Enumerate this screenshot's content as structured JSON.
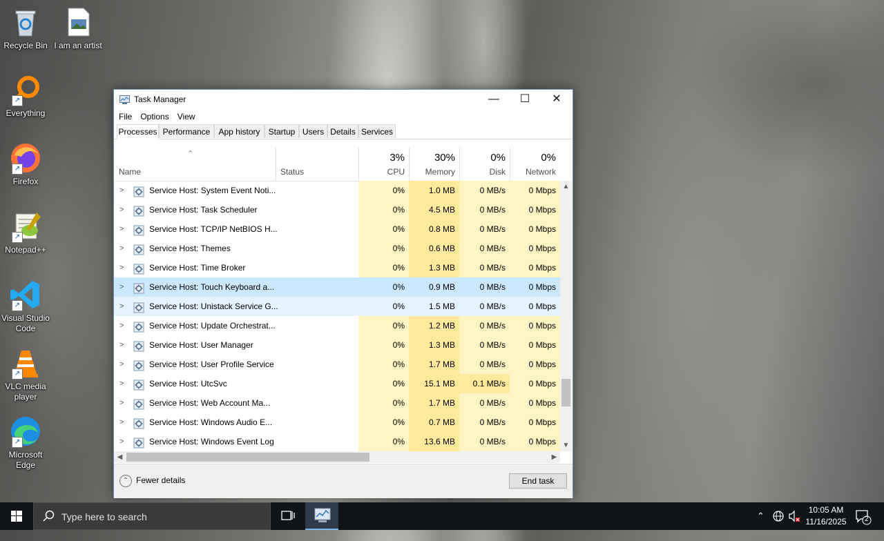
{
  "desktop": {
    "icons": [
      {
        "label": "Recycle Bin",
        "icon": "recycle-bin-icon"
      },
      {
        "label": "I am an artist",
        "icon": "image-file-icon"
      },
      {
        "label": "Everything",
        "icon": "everything-search-icon"
      },
      {
        "label": "Firefox",
        "icon": "firefox-icon"
      },
      {
        "label": "Notepad++",
        "icon": "notepad-plus-plus-icon"
      },
      {
        "label": "Visual Studio Code",
        "icon": "vscode-icon"
      },
      {
        "label": "VLC media player",
        "icon": "vlc-icon"
      },
      {
        "label": "Microsoft Edge",
        "icon": "edge-icon"
      }
    ]
  },
  "window": {
    "title": "Task Manager",
    "controls": {
      "minimize": "—",
      "maximize": "☐",
      "close": "✕"
    },
    "menu": [
      "File",
      "Options",
      "View"
    ],
    "tabs": [
      "Processes",
      "Performance",
      "App history",
      "Startup",
      "Users",
      "Details",
      "Services"
    ],
    "active_tab": "Processes"
  },
  "columns": {
    "name": "Name",
    "status": "Status",
    "cpu": {
      "pct": "3%",
      "label": "CPU"
    },
    "memory": {
      "pct": "30%",
      "label": "Memory"
    },
    "disk": {
      "pct": "0%",
      "label": "Disk"
    },
    "network": {
      "pct": "0%",
      "label": "Network"
    }
  },
  "rows": [
    {
      "name": "Service Host: System Event Noti...",
      "cpu": "0%",
      "memory": "1.0 MB",
      "disk": "0 MB/s",
      "network": "0 Mbps"
    },
    {
      "name": "Service Host: Task Scheduler",
      "cpu": "0%",
      "memory": "4.5 MB",
      "disk": "0 MB/s",
      "network": "0 Mbps"
    },
    {
      "name": "Service Host: TCP/IP NetBIOS H...",
      "cpu": "0%",
      "memory": "0.8 MB",
      "disk": "0 MB/s",
      "network": "0 Mbps"
    },
    {
      "name": "Service Host: Themes",
      "cpu": "0%",
      "memory": "0.6 MB",
      "disk": "0 MB/s",
      "network": "0 Mbps"
    },
    {
      "name": "Service Host: Time Broker",
      "cpu": "0%",
      "memory": "1.3 MB",
      "disk": "0 MB/s",
      "network": "0 Mbps"
    },
    {
      "name": "Service Host: Touch Keyboard a...",
      "cpu": "0%",
      "memory": "0.9 MB",
      "disk": "0 MB/s",
      "network": "0 Mbps"
    },
    {
      "name": "Service Host: Unistack Service G...",
      "cpu": "0%",
      "memory": "1.5 MB",
      "disk": "0 MB/s",
      "network": "0 Mbps"
    },
    {
      "name": "Service Host: Update Orchestrat...",
      "cpu": "0%",
      "memory": "1.2 MB",
      "disk": "0 MB/s",
      "network": "0 Mbps"
    },
    {
      "name": "Service Host: User Manager",
      "cpu": "0%",
      "memory": "1.3 MB",
      "disk": "0 MB/s",
      "network": "0 Mbps"
    },
    {
      "name": "Service Host: User Profile Service",
      "cpu": "0%",
      "memory": "1.7 MB",
      "disk": "0 MB/s",
      "network": "0 Mbps"
    },
    {
      "name": "Service Host: UtcSvc",
      "cpu": "0%",
      "memory": "15.1 MB",
      "disk": "0.1 MB/s",
      "network": "0 Mbps"
    },
    {
      "name": "Service Host: Web Account Ma...",
      "cpu": "0%",
      "memory": "1.7 MB",
      "disk": "0 MB/s",
      "network": "0 Mbps"
    },
    {
      "name": "Service Host: Windows Audio E...",
      "cpu": "0%",
      "memory": "0.7 MB",
      "disk": "0 MB/s",
      "network": "0 Mbps"
    },
    {
      "name": "Service Host: Windows Event Log",
      "cpu": "0%",
      "memory": "13.6 MB",
      "disk": "0 MB/s",
      "network": "0 Mbps"
    }
  ],
  "footer": {
    "fewer_details": "Fewer details",
    "end_task": "End task"
  },
  "taskbar": {
    "search_placeholder": "Type here to search",
    "time": "10:05 AM",
    "date": "11/16/2025",
    "notification_count": "2"
  }
}
